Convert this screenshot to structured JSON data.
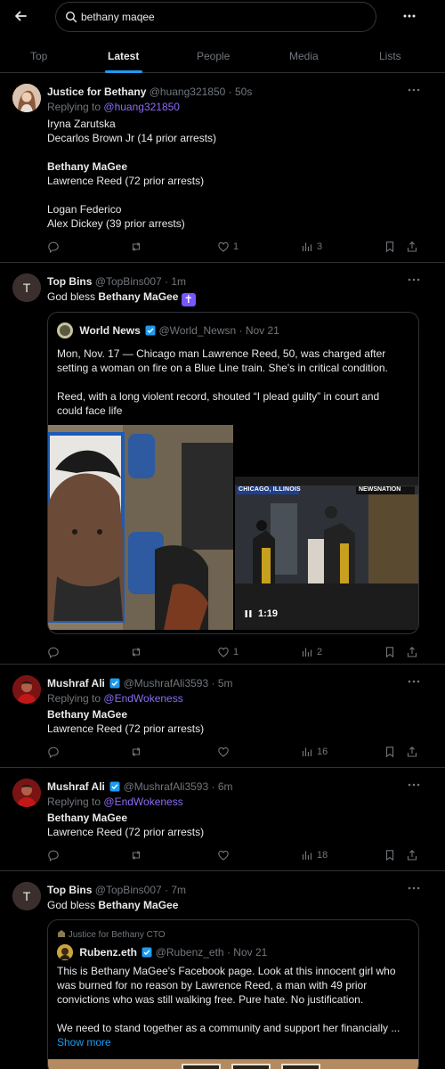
{
  "search": {
    "query": "bethany maqee",
    "placeholder": "Search"
  },
  "tabs": [
    {
      "label": "Top"
    },
    {
      "label": "Latest"
    },
    {
      "label": "People"
    },
    {
      "label": "Media"
    },
    {
      "label": "Lists"
    }
  ],
  "posts": [
    {
      "name": "Justice for Bethany",
      "handle": "@huang321850",
      "time": "· 50s",
      "replying_prefix": "Replying to",
      "replying_to": "@huang321850",
      "lines": [
        "Iryna Zarutska",
        "Decarlos Brown Jr (14 prior arrests)",
        "Bethany MaGee",
        "Lawrence Reed (72 prior arrests)",
        "Logan Federico",
        "Alex Dickey (39 prior arrests)"
      ],
      "likes": "1",
      "views": "3"
    },
    {
      "name": "Top Bins",
      "handle": "@TopBins007",
      "time": "· 1m",
      "avatar_letter": "T",
      "text_prefix": "God bless",
      "text_bold": "Bethany MaGee",
      "cross": "✝",
      "quote": {
        "name": "World News",
        "handle": "@World_Newsn",
        "time": "· Nov 21",
        "p1": [
          "Mon, Nov. 17 — Chicago man Lawrence Reed, 50, was charged after",
          "setting a woman on fire on a Blue Line train. She's in critical condition."
        ],
        "p2": [
          "Reed, with a long violent record, shouted “I plead guilty” in court and",
          "could face life"
        ],
        "video_tag_left": "CHICAGO, ILLINOIS",
        "video_tag_right": "NEWSNATION",
        "duration": "1:19"
      },
      "likes": "1",
      "views": "2"
    },
    {
      "name": "Mushraf Ali",
      "handle": "@MushrafAli3593",
      "time": "· 5m",
      "replying_prefix": "Replying to",
      "replying_to": "@EndWokeness",
      "line_bold": "Bethany MaGee",
      "line2": "Lawrence Reed (72 prior arrests)",
      "views": "16"
    },
    {
      "name": "Mushraf Ali",
      "handle": "@MushrafAli3593",
      "time": "· 6m",
      "replying_prefix": "Replying to",
      "replying_to": "@EndWokeness",
      "line_bold": "Bethany MaGee",
      "line2": "Lawrence Reed (72 prior arrests)",
      "views": "18"
    },
    {
      "name": "Top Bins",
      "handle": "@TopBins007",
      "time": "· 7m",
      "avatar_letter": "T",
      "text_prefix": "God bless",
      "text_bold": "Bethany MaGee",
      "quote": {
        "affiliation": "Justice for Bethany CTO",
        "name": "Rubenz.eth",
        "handle": "@Rubenz_eth",
        "time": "· Nov 21",
        "p1": [
          "This is Bethany MaGee's Facebook page. Look at this innocent girl who",
          "was burned for no reason by Lawrence Reed, a man with 49 prior",
          "convictions who was still walking free. Pure hate. No justification."
        ],
        "p2": [
          "We need to stand together as a community and support her financially ..."
        ],
        "show_more": "Show more"
      }
    }
  ],
  "colors": {
    "accent": "#1d9bf0",
    "mention": "#8a6cf5",
    "muted": "#71767b",
    "border": "#2f3336"
  }
}
